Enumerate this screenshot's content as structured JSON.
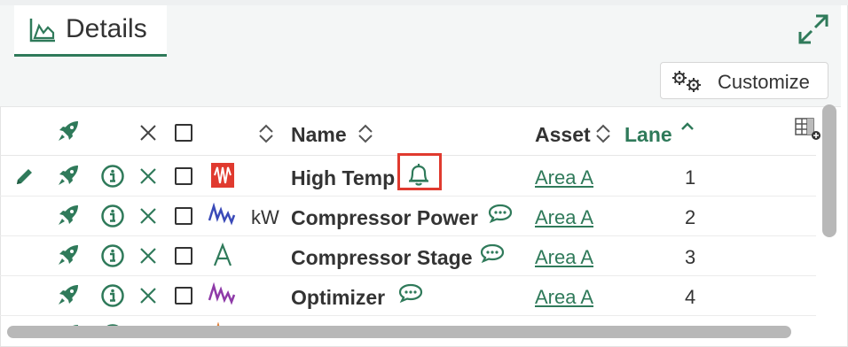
{
  "header": {
    "tab_label": "Details",
    "tab_icon": "area-chart-icon",
    "expand_icon": "expand-icon"
  },
  "toolbar": {
    "customize_label": "Customize",
    "customize_icon": "gears-icon"
  },
  "columns": {
    "name": "Name",
    "asset": "Asset",
    "lane": "Lane",
    "lane_sort": "ascending"
  },
  "rows": [
    {
      "unit": "",
      "name": "High Temp",
      "name_icon": "bell-icon",
      "asset": "Area A",
      "lane": "1",
      "signal_icon": "condition-red-icon",
      "edit": true
    },
    {
      "unit": "kW",
      "name": "Compressor Power",
      "name_icon": "comment-icon",
      "asset": "Area A",
      "lane": "2",
      "signal_icon": "signal-blue-icon",
      "edit": false
    },
    {
      "unit": "",
      "name": "Compressor Stage",
      "name_icon": "comment-icon",
      "asset": "Area A",
      "lane": "3",
      "signal_icon": "string-signal-icon",
      "edit": false
    },
    {
      "unit": "",
      "name": "Optimizer",
      "name_icon": "comment-icon",
      "asset": "Area A",
      "lane": "4",
      "signal_icon": "signal-purple-icon",
      "edit": false
    }
  ],
  "colors": {
    "accent": "#2f7a5a",
    "alert_outline": "#e03a2f",
    "condition": "#e03a2f",
    "signal_blue": "#3a4ab8",
    "signal_purple": "#8e3aa8",
    "signal_orange": "#e07a2f"
  }
}
